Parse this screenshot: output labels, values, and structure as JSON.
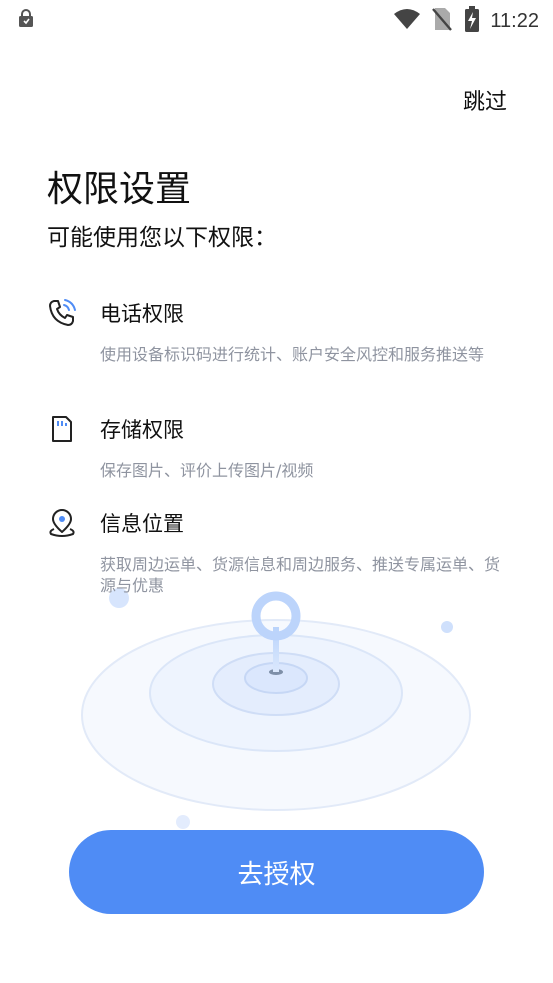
{
  "status_bar": {
    "time": "11:22"
  },
  "header": {
    "skip_label": "跳过"
  },
  "page": {
    "title": "权限设置",
    "subtitle": "可能使用您以下权限："
  },
  "permissions": [
    {
      "icon": "phone-icon",
      "title": "电话权限",
      "description": "使用设备标识码进行统计、账户安全风控和服务推送等"
    },
    {
      "icon": "sd-card-icon",
      "title": "存储权限",
      "description": "保存图片、评价上传图片/视频"
    },
    {
      "icon": "location-pin-icon",
      "title": "信息位置",
      "description": "获取周边运单、货源信息和周边服务、推送专属运单、货源与优惠"
    }
  ],
  "cta": {
    "label": "去授权"
  },
  "colors": {
    "accent": "#4f8cf5",
    "desc_text": "#8f94a0",
    "radar": "#e9f0fd",
    "pin": "#bfd6fb"
  }
}
